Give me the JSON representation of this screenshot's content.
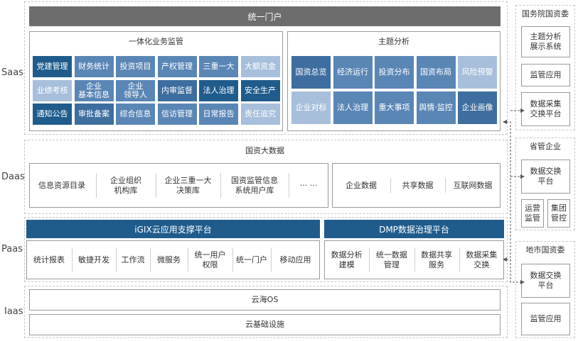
{
  "layers": {
    "saas": "Saas",
    "daas": "Daas",
    "paas": "Paas",
    "iaas": "Iaas"
  },
  "portal": "统一门户",
  "bizsup": {
    "title": "一体化业务监管",
    "cells": [
      {
        "text": "党建管理",
        "style": "c1"
      },
      {
        "text": "财务统计",
        "style": "c2"
      },
      {
        "text": "投资项目",
        "style": "c2"
      },
      {
        "text": "产权管理",
        "style": "c2"
      },
      {
        "text": "三重一大",
        "style": "c2"
      },
      {
        "text": "大额资金",
        "style": "c3"
      },
      {
        "text": "业绩考核",
        "style": "c3"
      },
      {
        "text": "企业\n基本信息",
        "style": "c2"
      },
      {
        "text": "企业\n领导人",
        "style": "c2"
      },
      {
        "text": "内审监督",
        "style": "c4"
      },
      {
        "text": "法人治理",
        "style": "c1"
      },
      {
        "text": "安全生产",
        "style": "c1"
      },
      {
        "text": "通知公告",
        "style": "c1"
      },
      {
        "text": "审批备案",
        "style": "c4"
      },
      {
        "text": "综合信息",
        "style": "c2"
      },
      {
        "text": "信访管理",
        "style": "c2"
      },
      {
        "text": "日常报告",
        "style": "c2"
      },
      {
        "text": "责任追究",
        "style": "c3"
      }
    ]
  },
  "analysis": {
    "title": "主题分析",
    "cells": [
      {
        "text": "国资总览",
        "style": "c4"
      },
      {
        "text": "经济运行",
        "style": "c2"
      },
      {
        "text": "投资分布",
        "style": "c2"
      },
      {
        "text": "国资布局",
        "style": "c2"
      },
      {
        "text": "风险预警",
        "style": "c3"
      },
      {
        "text": "企业对标",
        "style": "c3"
      },
      {
        "text": "法人治理",
        "style": "c2"
      },
      {
        "text": "重大事项",
        "style": "c2"
      },
      {
        "text": "舆情·监控",
        "style": "c2"
      },
      {
        "text": "企业画像",
        "style": "c4"
      }
    ]
  },
  "bigdata": {
    "title": "国资大数据",
    "left": [
      "信息资源目录",
      "企业组织\n机构库",
      "企业三重一大\n决策库",
      "国资监管信息\n系统用户库",
      "··· ···"
    ],
    "right": [
      "企业数据",
      "共享数据",
      "互联网数据"
    ]
  },
  "igix": {
    "title": "iGIX云应用支撑平台",
    "items": [
      "统计报表",
      "敏捷开发",
      "工作流",
      "微服务",
      "统一用户\n权限",
      "统一门户",
      "移动应用"
    ]
  },
  "dmp": {
    "title": "DMP数据治理平台",
    "items": [
      "数据分析\n建模",
      "统一数据\n管理",
      "数据共享\n服务",
      "数据采集\n交换"
    ]
  },
  "iaas": {
    "os": "云海OS",
    "infra": "云基础设施"
  },
  "side": {
    "g1": {
      "title": "国务院国资委",
      "items": [
        "主题分析\n展示系统",
        "监管应用",
        "数据采集\n交换平台"
      ]
    },
    "g2": {
      "title": "省管企业",
      "items": [
        "数据交换\n平台"
      ],
      "small": [
        "运营\n监管",
        "集团\n管控"
      ]
    },
    "g3": {
      "title": "地市国资委",
      "items": [
        "数据交换\n平台",
        "监管应用"
      ]
    }
  }
}
